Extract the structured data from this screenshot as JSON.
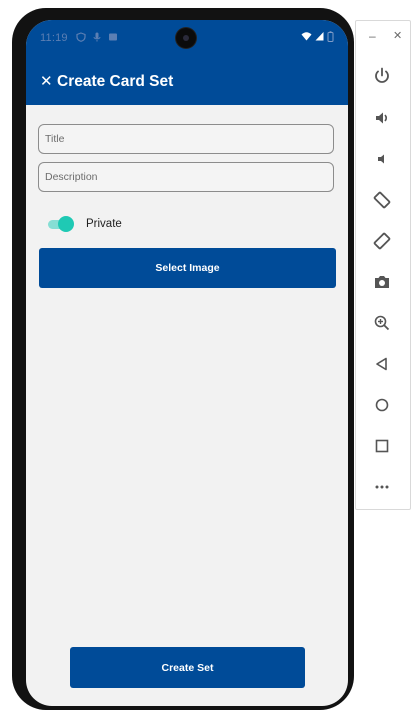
{
  "status_bar": {
    "time": "11:19",
    "left_icons": [
      "shield-icon",
      "mic-icon",
      "card-icon"
    ],
    "right_icons": [
      "wifi-icon",
      "signal-icon",
      "battery-icon"
    ]
  },
  "app_bar": {
    "close_icon": "close-icon",
    "close_glyph": "✕",
    "title": "Create Card Set"
  },
  "form": {
    "title_placeholder": "Title",
    "description_placeholder": "Description",
    "private_label": "Private",
    "private_checked": true,
    "select_image_label": "Select Image"
  },
  "footer": {
    "create_set_label": "Create Set"
  },
  "emulator_panel": {
    "minimize_glyph": "–",
    "close_glyph": "✕",
    "tools": [
      "power-icon",
      "volume-up-icon",
      "volume-down-icon",
      "rotate-left-icon",
      "rotate-right-icon",
      "camera-icon",
      "zoom-in-icon",
      "back-icon",
      "home-icon",
      "overview-icon",
      "more-icon"
    ]
  },
  "colors": {
    "primary": "#004b98",
    "accent": "#1fc9b4",
    "screen_background": "#f2f2f2"
  }
}
